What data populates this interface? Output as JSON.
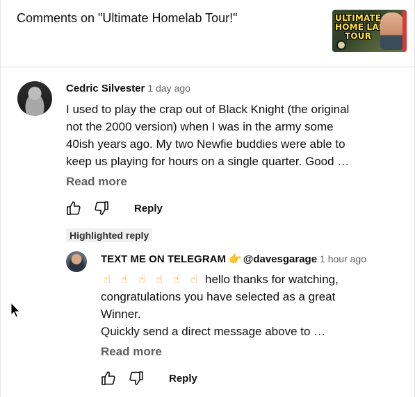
{
  "header": {
    "title": "Comments on \"Ultimate Homelab Tour!\"",
    "thumbnail_text": [
      "ULTIMATE",
      "HOME LAB",
      "TOUR"
    ]
  },
  "comment": {
    "author": "Cedric Silvester",
    "time": "1 day ago",
    "lines": [
      "I used to play the crap out of Black Knight (the original",
      "not the 2000 version) when I was in the army some",
      "40ish years ago.  My two Newfie buddies were able to",
      "keep us playing for hours on a single quarter.  Good …"
    ],
    "read_more": "Read more",
    "reply": "Reply"
  },
  "reply": {
    "badge": "Highlighted reply",
    "author_prefix": "TEXT ME ON TELEGRAM",
    "author_emoji": "👉",
    "author_handle": "@davesgarage",
    "time": "1 hour ago",
    "hand_emoji": "☝",
    "line1_text": "hello thanks for watching,",
    "lines": [
      "congratulations you have selected as a great",
      "Winner.",
      "Quickly send a direct message above to …"
    ],
    "read_more": "Read more",
    "reply": "Reply"
  },
  "icons": [
    "thumbs-up-icon",
    "thumbs-down-icon",
    "mouse-pointer-icon"
  ],
  "colors": {
    "text": "#0f0f0f",
    "secondary": "#606060",
    "badge_bg": "#f0f0f0",
    "emoji": "#e7a21b"
  }
}
